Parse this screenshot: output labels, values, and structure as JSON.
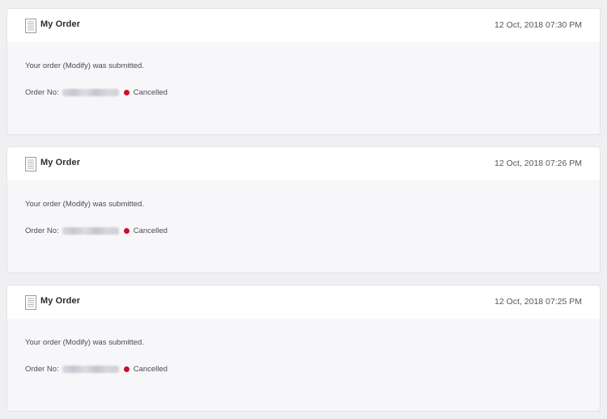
{
  "status_color": "#c8102e",
  "orders": [
    {
      "title": "My Order",
      "timestamp": "12 Oct, 2018 07:30 PM",
      "message": "Your order (Modify) was submitted.",
      "order_no_label": "Order No:",
      "order_no": "",
      "status": "Cancelled"
    },
    {
      "title": "My Order",
      "timestamp": "12 Oct, 2018 07:26 PM",
      "message": "Your order (Modify) was submitted.",
      "order_no_label": "Order No:",
      "order_no": "",
      "status": "Cancelled"
    },
    {
      "title": "My Order",
      "timestamp": "12 Oct, 2018 07:25 PM",
      "message": "Your order (Modify) was submitted.",
      "order_no_label": "Order No:",
      "order_no": "",
      "status": "Cancelled"
    }
  ]
}
